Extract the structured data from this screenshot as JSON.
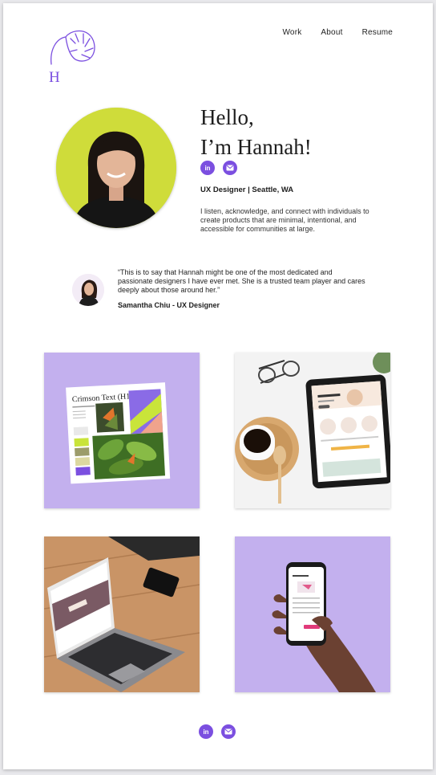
{
  "nav": {
    "items": [
      "Work",
      "About",
      "Resume"
    ]
  },
  "logo": {
    "monogram": "H"
  },
  "hero": {
    "greeting_line1": "Hello,",
    "greeting_line2": "I’m Hannah!",
    "role": "UX Designer | Seattle, WA",
    "bio": "I listen, acknowledge, and connect with individuals to create products that are minimal, intentional, and accessible for communities at large."
  },
  "social": {
    "linkedin_label": "in",
    "email_icon": "envelope-icon"
  },
  "testimonial": {
    "quote": "“This is to say that Hannah might be one of the most dedicated and passionate designers I have ever met. She is a trusted team player and cares deeply about those around her.”",
    "author": "Samantha Chiu - UX Designer"
  },
  "projects": {
    "style_guide_heading": "Crimson Text (H1)"
  },
  "colors": {
    "accent": "#7b4fe0",
    "lavender": "#c3b0ee",
    "lime": "#cfdc3a"
  }
}
